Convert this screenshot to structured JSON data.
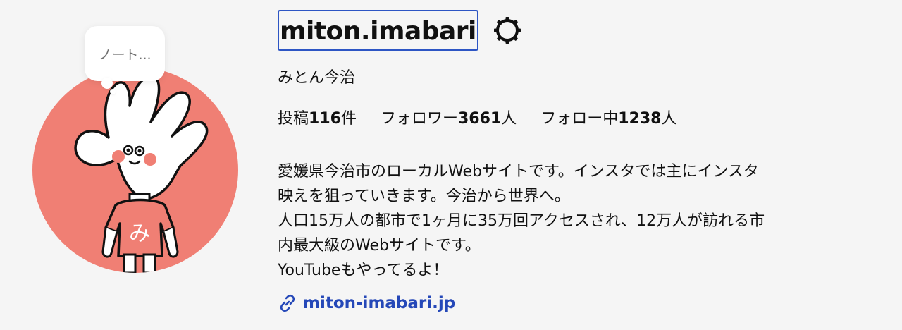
{
  "profile": {
    "username": "miton.imabari",
    "full_name": "みとん今治",
    "note_bubble": "ノート...",
    "stats": {
      "posts_label": "投稿",
      "posts_count": "116",
      "posts_unit": "件",
      "followers_label": "フォロワー",
      "followers_count": "3661",
      "followers_unit": "人",
      "following_label": "フォロー中",
      "following_count": "1238",
      "following_unit": "人"
    },
    "bio_lines": [
      "愛媛県今治市のローカルWebサイトです。インスタでは主にインスタ",
      "映えを狙っていきます。今治から世界へ。",
      "人口15万人の都市で1ヶ月に35万回アクセスされ、12万人が訪れる市",
      "内最大級のWebサイトです。",
      "YouTubeもやってるよ！"
    ],
    "website": "miton-imabari.jp"
  },
  "icons": {
    "settings": "gear-icon",
    "website": "link-icon"
  },
  "colors": {
    "background": "#f5f5f5",
    "avatar_bg": "#f07f74",
    "link": "#2548b8",
    "username_focus_border": "#2d55c4"
  }
}
